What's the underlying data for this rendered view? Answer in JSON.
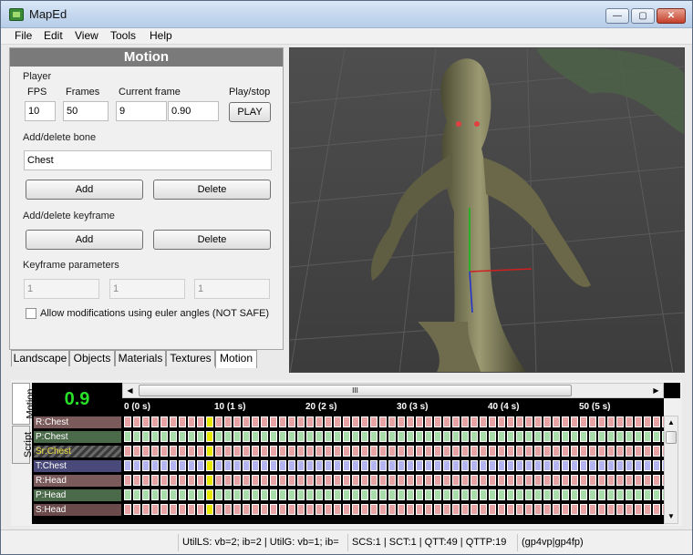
{
  "window": {
    "title": "MapEd"
  },
  "menu": [
    "File",
    "Edit",
    "View",
    "Tools",
    "Help"
  ],
  "panel": {
    "title": "Motion",
    "player": {
      "group": "Player",
      "fps_label": "FPS",
      "fps_value": "10",
      "frames_label": "Frames",
      "frames_value": "50",
      "current_label": "Current frame",
      "current_value": "9",
      "current_time": "0.90",
      "playstop_label": "Play/stop",
      "play_button": "PLAY"
    },
    "bone": {
      "group": "Add/delete bone",
      "value": "Chest",
      "add": "Add",
      "delete": "Delete"
    },
    "keyframe": {
      "group": "Add/delete keyframe",
      "add": "Add",
      "delete": "Delete"
    },
    "params": {
      "group": "Keyframe parameters",
      "p1": "1",
      "p2": "1",
      "p3": "1"
    },
    "euler_checkbox": "Allow modifications using euler angles (NOT SAFE)"
  },
  "tabs": [
    "Landscape",
    "Objects",
    "Materials",
    "Textures",
    "Motion"
  ],
  "active_tab": "Motion",
  "side_tabs": [
    "Motion",
    "Script"
  ],
  "timeline": {
    "current_display": "0.9",
    "scroll_grip": "III",
    "ticks": [
      "0 (0 s)",
      "10 (1 s)",
      "20 (2 s)",
      "30 (3 s)",
      "40 (4 s)",
      "50 (5 s)"
    ],
    "tracks": [
      {
        "name": "R:Chest",
        "color": "#e8a4a4",
        "label_bg": "#7a5a5a"
      },
      {
        "name": "P:Chest",
        "color": "#a8dca8",
        "label_bg": "#4a6a4a"
      },
      {
        "name": "Sr:Chest",
        "color": "#e8a4a4",
        "label_bg": "#5a5a5a",
        "highlight": true
      },
      {
        "name": "T:Chest",
        "color": "#b4b4f0",
        "label_bg": "#4a4a7a"
      },
      {
        "name": "R:Head",
        "color": "#e8a4a4",
        "label_bg": "#7a5a5a"
      },
      {
        "name": "P:Head",
        "color": "#a8dca8",
        "label_bg": "#4a6a4a"
      },
      {
        "name": "S:Head",
        "color": "#e8a4a4",
        "label_bg": "#6a4a4a"
      }
    ],
    "current_frame_index": 9
  },
  "status": {
    "s1": "UtilLS: vb=2; ib=2 | UtilG: vb=1; ib=",
    "s2": "SCS:1 | SCT:1 | QTT:49 | QTTP:19",
    "s3": "(gp4vp|gp4fp)"
  },
  "colors": {
    "accent_green": "#28e028",
    "cursor_yellow": "#e8e800",
    "panel_header": "#7a7a7a"
  }
}
